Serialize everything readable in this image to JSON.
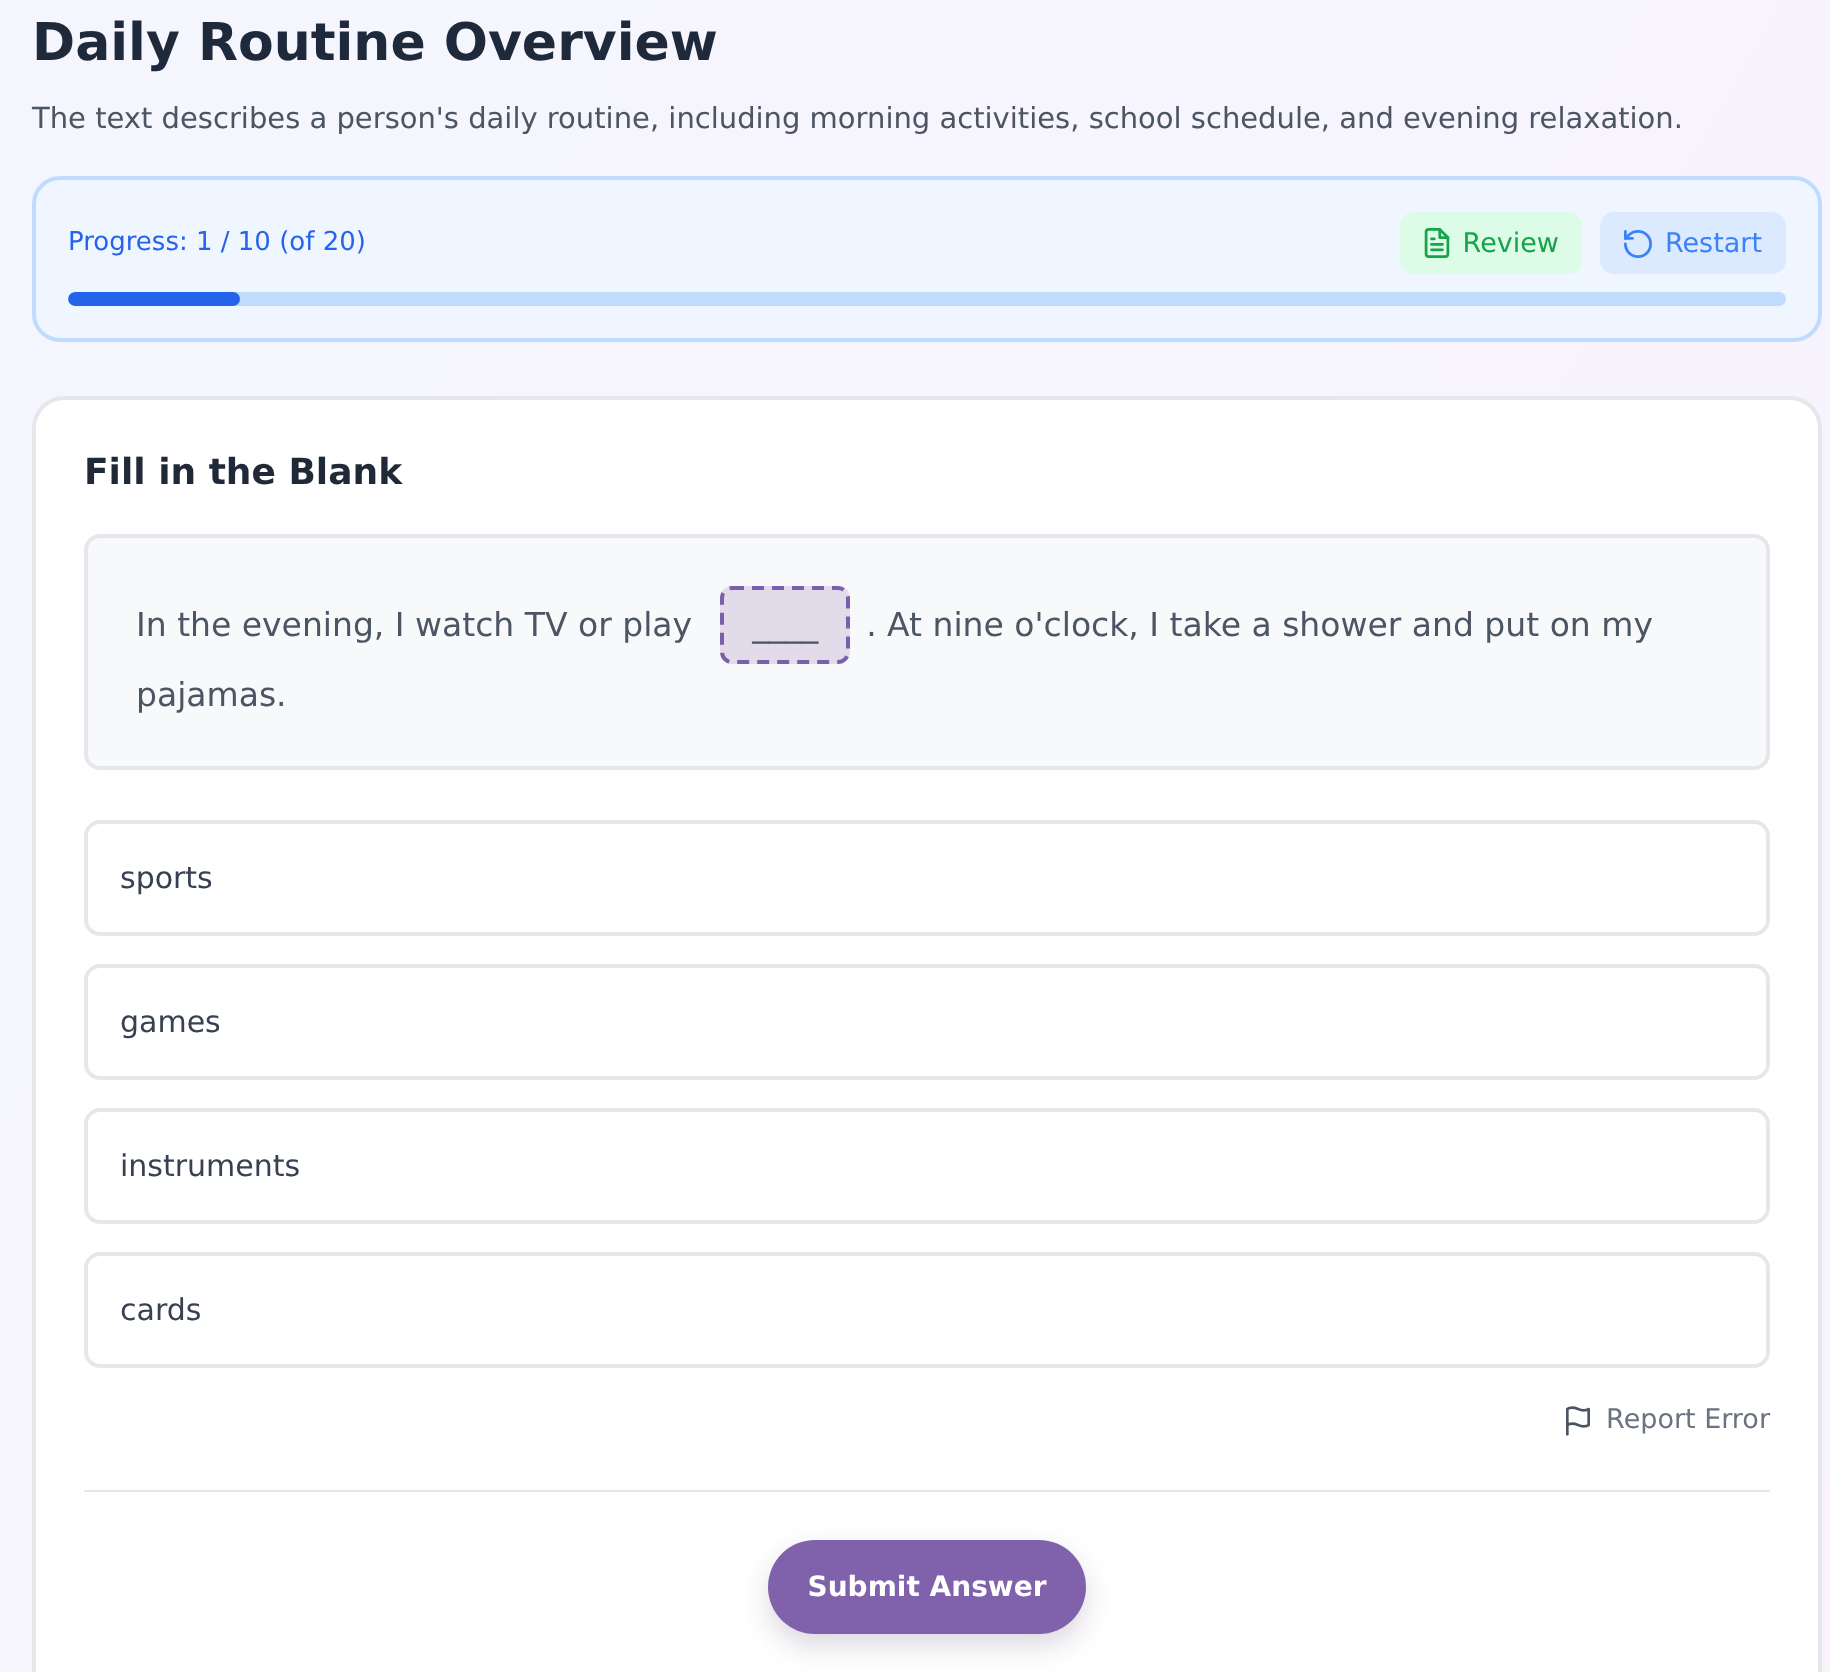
{
  "page": {
    "title": "Daily Routine Overview",
    "description": "The text describes a person's daily routine, including morning activities, school schedule, and evening relaxation."
  },
  "progress": {
    "label": "Progress: 1 / 10 (of 20)",
    "level": 0.1,
    "buttons": [
      {
        "kind": "review",
        "label": "Review"
      },
      {
        "kind": "restart",
        "label": "Restart"
      }
    ]
  },
  "question": {
    "heading": "Fill in the Blank",
    "text_before": "In the evening, I watch TV or play",
    "blank": "____",
    "text_after": ". At nine o'clock, I take a shower and put on my",
    "text_continued": "pajamas.",
    "options": [
      {
        "label": "sports",
        "selected": false
      },
      {
        "label": "games",
        "selected": false
      },
      {
        "label": "instruments",
        "selected": false
      },
      {
        "label": "cards",
        "selected": false
      }
    ],
    "report_link": "Report Error",
    "submit_button": "Submit Answer"
  }
}
